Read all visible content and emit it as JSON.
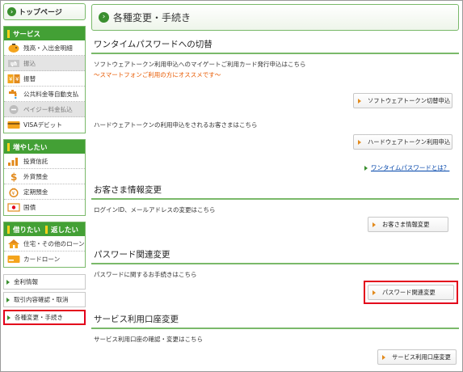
{
  "sidebar": {
    "top_page": "トップページ",
    "service": {
      "header": "サービス",
      "items": [
        {
          "label": "残高・入出金明細",
          "disabled": false
        },
        {
          "label": "振込",
          "disabled": true
        },
        {
          "label": "振替",
          "disabled": false
        },
        {
          "label": "公共料金等自動支払",
          "disabled": false
        },
        {
          "label": "ペイジー料金払込",
          "disabled": true
        },
        {
          "label": "VISAデビット",
          "disabled": false
        }
      ]
    },
    "increase": {
      "header": "増やしたい",
      "items": [
        {
          "label": "投資信託"
        },
        {
          "label": "外貨預金"
        },
        {
          "label": "定期預金"
        },
        {
          "label": "国債"
        }
      ]
    },
    "borrow": {
      "header_left": "借りたい",
      "header_right": "返したい",
      "items": [
        {
          "label": "住宅・その他のローン"
        },
        {
          "label": "カードローン"
        }
      ]
    },
    "links": [
      {
        "label": "金利情報",
        "selected": false
      },
      {
        "label": "取引内容確認・取消",
        "selected": false
      },
      {
        "label": "各種変更・手続き",
        "selected": true
      }
    ]
  },
  "main": {
    "title": "各種変更・手続き",
    "onetime": {
      "title": "ワンタイムパスワードへの切替",
      "text1": "ソフトウェアトークン利用申込へのマイゲートご利用カード発行申込はこちら",
      "note": "～スマートフォンご利用の方にオススメです～",
      "button1": "ソフトウェアトークン切替申込",
      "text2": "ハードウェアトークンの利用申込をされるお客さまはこちら",
      "button2": "ハードウェアトークン利用申込",
      "help_link": "ワンタイムパスワードとは？"
    },
    "customer": {
      "title": "お客さま情報変更",
      "text": "ログインID、メールアドレスの変更はこちら",
      "button": "お客さま情報変更"
    },
    "password": {
      "title": "パスワード関連変更",
      "text": "パスワードに関するお手続きはこちら",
      "button": "パスワード関連変更"
    },
    "account": {
      "title": "サービス利用口座変更",
      "text": "サービス利用口座の確認・変更はこちら",
      "button": "サービス利用口座変更"
    }
  },
  "colors": {
    "brand_green": "#43a035",
    "highlight_red": "#e3001b",
    "note_orange": "#e85a00",
    "link_blue": "#0044aa"
  }
}
